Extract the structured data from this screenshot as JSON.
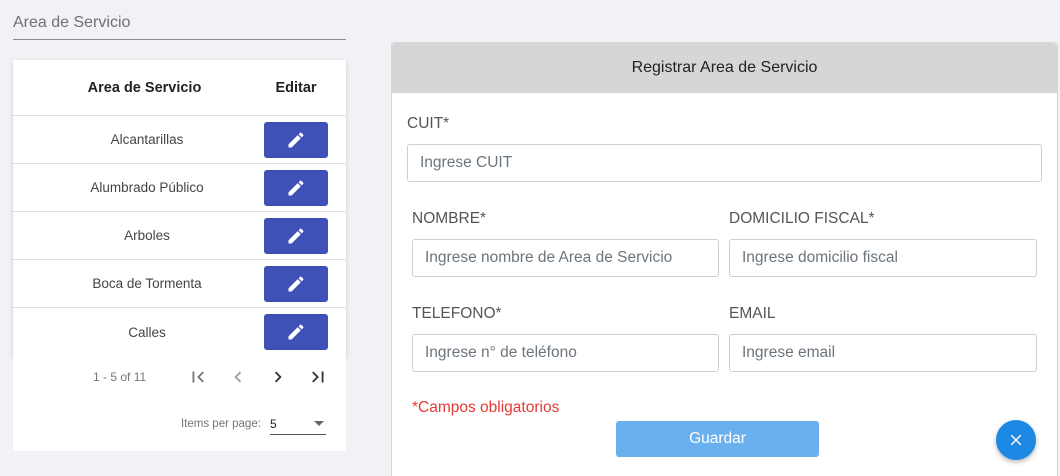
{
  "filter": {
    "placeholder": "Area de Servicio"
  },
  "table": {
    "headers": {
      "name": "Area de Servicio",
      "edit": "Editar"
    },
    "rows": [
      {
        "name": "Alcantarillas"
      },
      {
        "name": "Alumbrado Público"
      },
      {
        "name": "Arboles"
      },
      {
        "name": "Boca de Tormenta"
      },
      {
        "name": "Calles"
      }
    ],
    "edit_icon": "pencil-icon",
    "accent_color": "#3f51b5"
  },
  "paginator": {
    "range_label": "1 - 5 of 11",
    "items_per_page_label": "Items per page:",
    "items_per_page_value": "5"
  },
  "form": {
    "title": "Registrar Area de Servicio",
    "cuit": {
      "label": "CUIT*",
      "placeholder": "Ingrese CUIT"
    },
    "nombre": {
      "label": "NOMBRE*",
      "placeholder": "Ingrese nombre de Area de Servicio"
    },
    "domicilio": {
      "label": "DOMICILIO FISCAL*",
      "placeholder": "Ingrese domicilio fiscal"
    },
    "telefono": {
      "label": "TELEFONO*",
      "placeholder": "Ingrese n° de teléfono"
    },
    "email": {
      "label": "EMAIL",
      "placeholder": "Ingrese email"
    },
    "required_note": "*Campos obligatorios",
    "save_label": "Guardar",
    "save_color": "#6bb0ee",
    "required_color": "#e53935"
  },
  "fab": {
    "icon": "close-icon",
    "color": "#1e88e5"
  }
}
